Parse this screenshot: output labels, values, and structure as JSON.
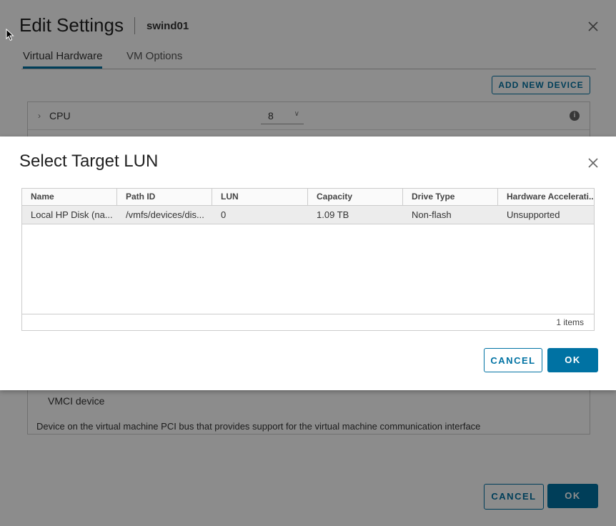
{
  "background": {
    "title": "Edit Settings",
    "vm_name": "swind01",
    "tabs": [
      {
        "label": "Virtual Hardware",
        "active": true
      },
      {
        "label": "VM Options",
        "active": false
      }
    ],
    "add_device_label": "ADD NEW DEVICE",
    "cpu": {
      "label": "CPU",
      "value": "8"
    },
    "vmci": {
      "label": "VMCI device",
      "description": "Device on the virtual machine PCI bus that provides support for the virtual machine communication interface"
    },
    "cancel_label": "CANCEL",
    "ok_label": "OK"
  },
  "dialog": {
    "title": "Select Target LUN",
    "columns": [
      "Name",
      "Path ID",
      "LUN",
      "Capacity",
      "Drive Type",
      "Hardware Accelerati..."
    ],
    "rows": [
      [
        "Local HP Disk (na...",
        "/vmfs/devices/dis...",
        "0",
        "1.09 TB",
        "Non-flash",
        "Unsupported"
      ]
    ],
    "item_count": "1 items",
    "cancel_label": "CANCEL",
    "ok_label": "OK"
  },
  "colors": {
    "accent": "#0072a3",
    "overlay": "#000000"
  }
}
